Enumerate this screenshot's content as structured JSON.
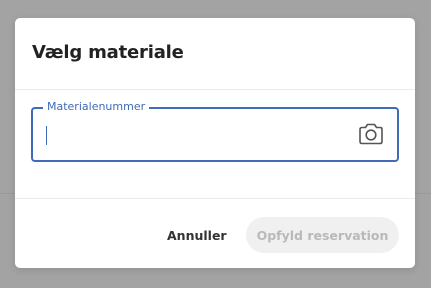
{
  "dialog": {
    "title": "Vælg materiale",
    "field": {
      "label": "Materialenummer",
      "value": "",
      "placeholder": "",
      "camera_icon": "camera-icon"
    },
    "actions": {
      "cancel_label": "Annuller",
      "confirm_label": "Opfyld reservation",
      "confirm_disabled": true
    }
  },
  "colors": {
    "accent": "#3f6bb8",
    "overlay": "#a3a3a3",
    "disabled_bg": "#f0f0f0",
    "disabled_text": "#b9b9b9"
  }
}
